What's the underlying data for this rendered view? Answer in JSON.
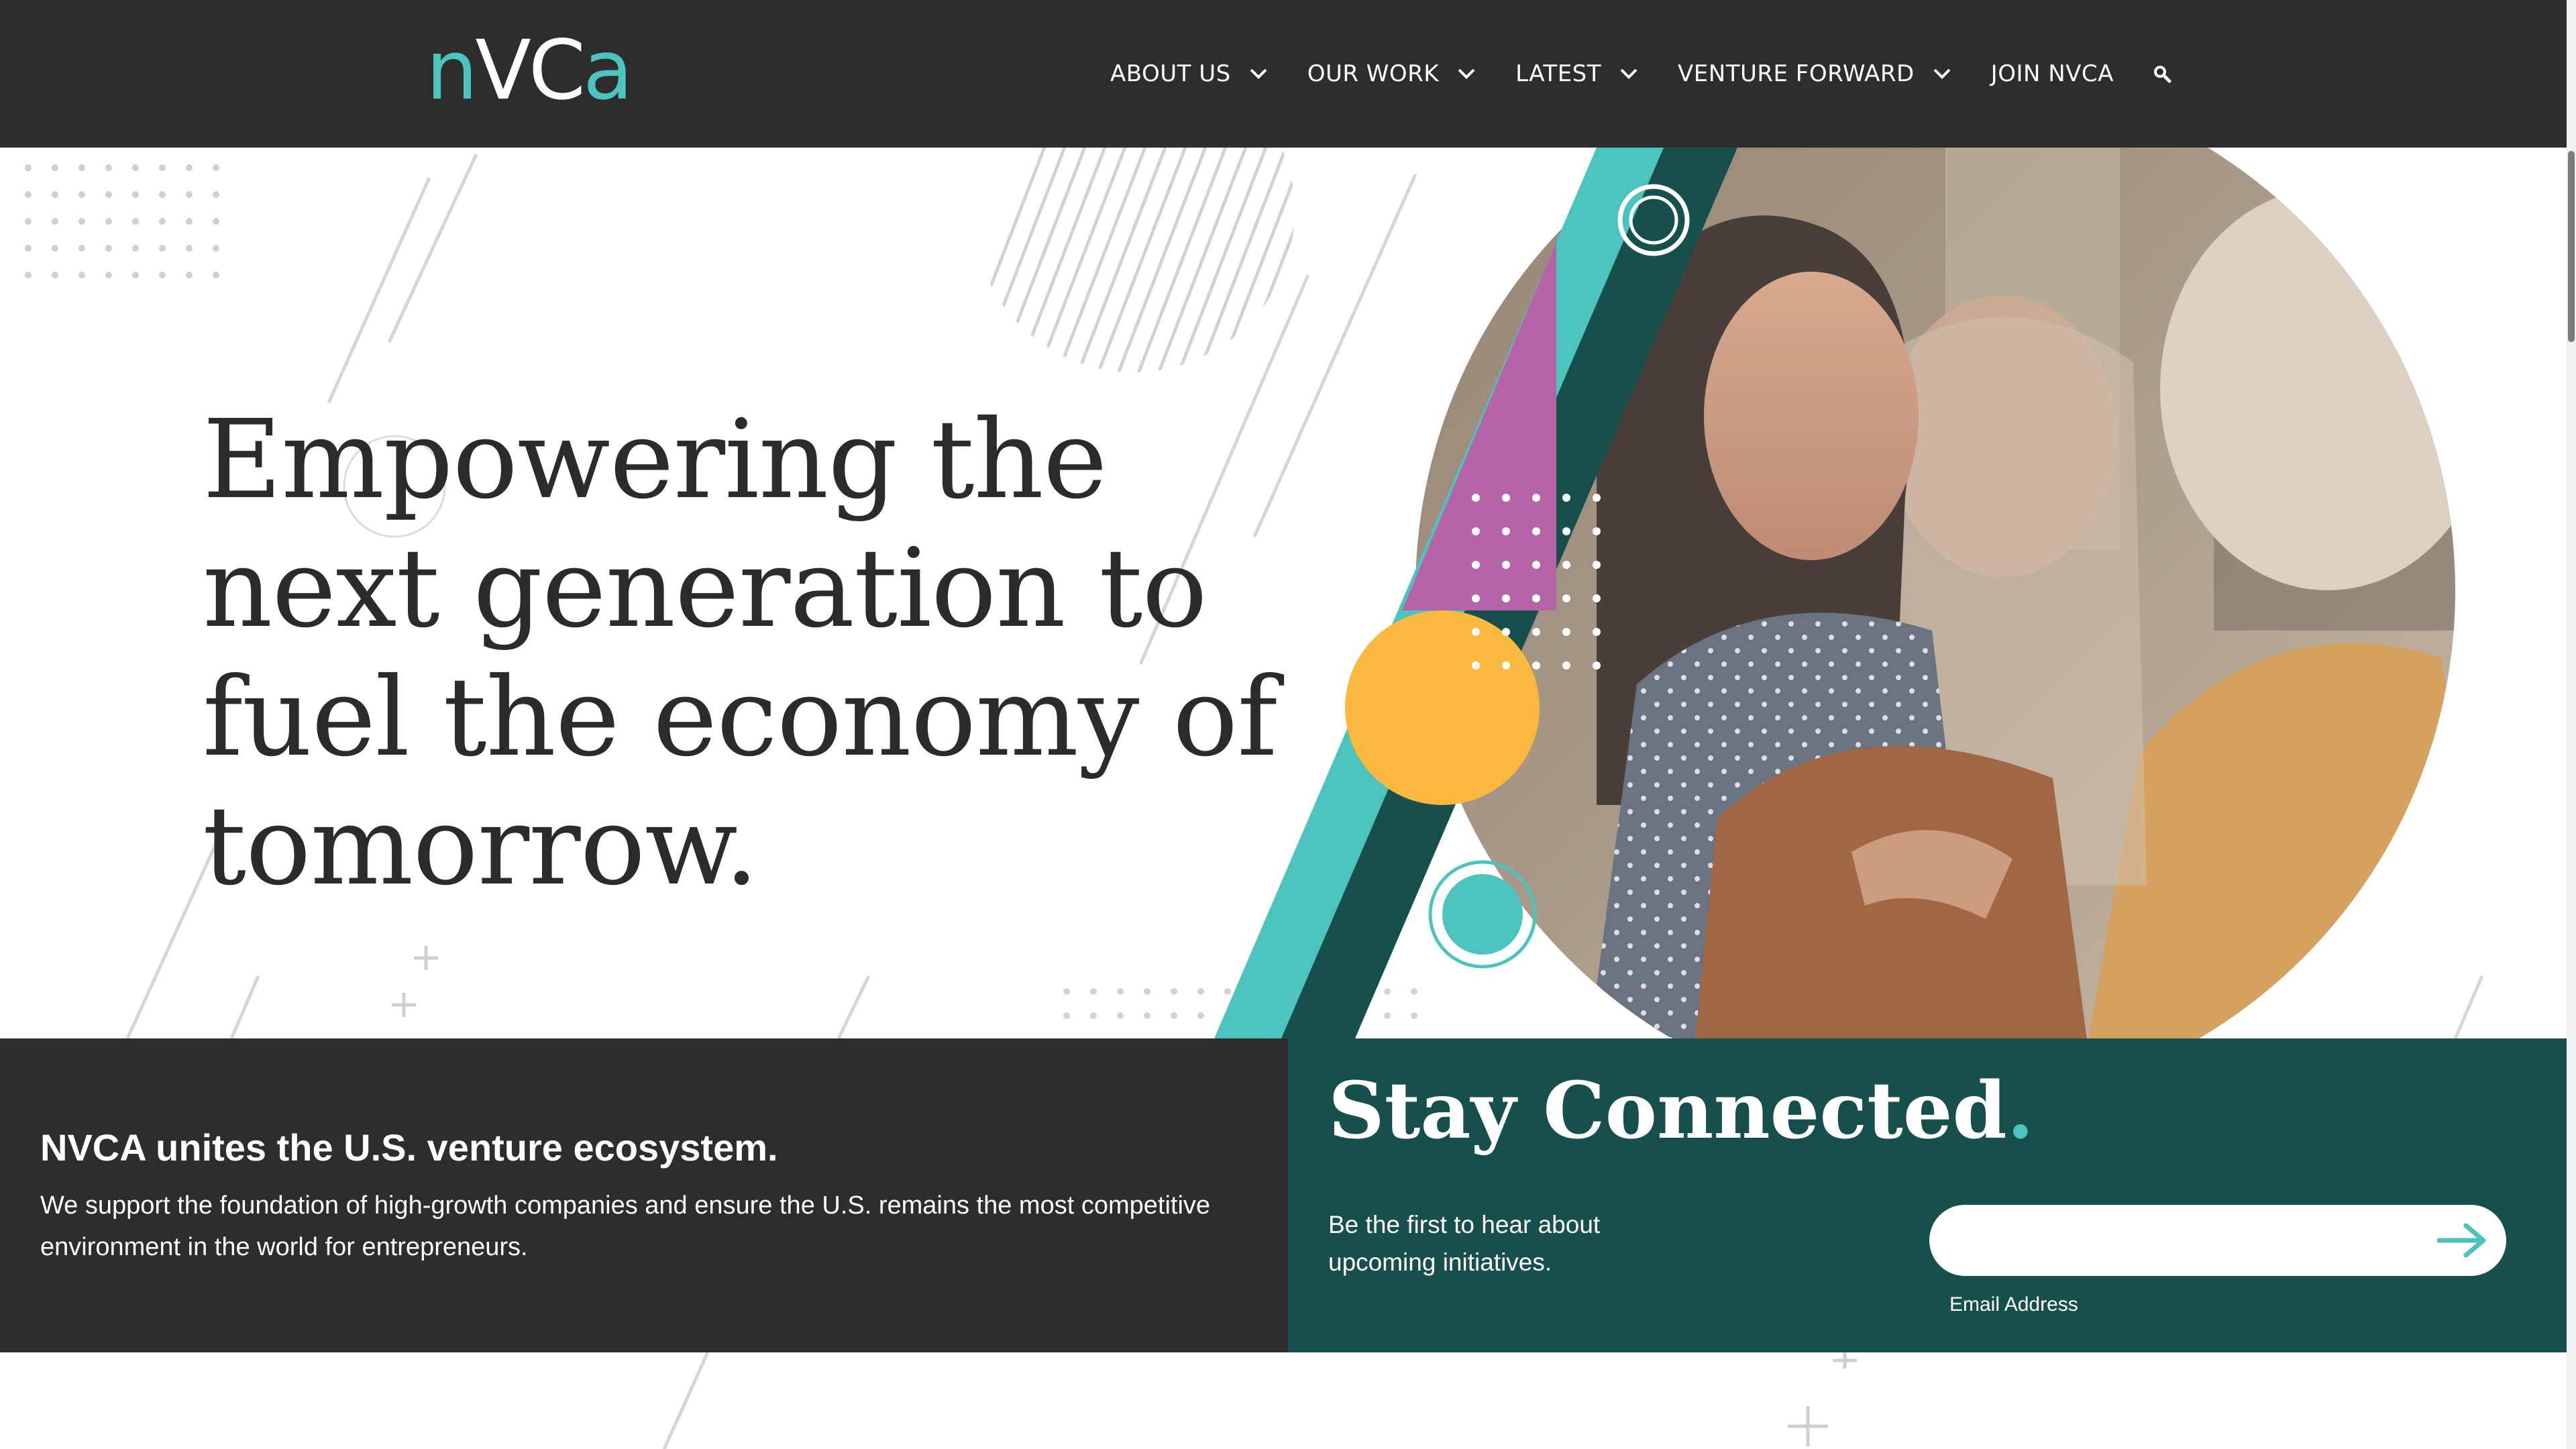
{
  "header": {
    "logo_text_a": "n",
    "logo_text_b": "VC",
    "logo_text_c": "a",
    "nav": [
      {
        "label": "ABOUT US",
        "has_dropdown": true
      },
      {
        "label": "OUR WORK",
        "has_dropdown": true
      },
      {
        "label": "LATEST",
        "has_dropdown": true
      },
      {
        "label": "VENTURE FORWARD",
        "has_dropdown": true
      },
      {
        "label": "JOIN NVCA",
        "has_dropdown": false
      }
    ],
    "search_icon": "search-icon"
  },
  "hero": {
    "title": "Empowering the next generation to fuel the economy of tomorrow."
  },
  "about_band": {
    "title": "NVCA unites the U.S. venture ecosystem.",
    "body": "We support the foundation of high-growth companies and ensure the U.S. remains the most competitive environment in the world for entrepreneurs."
  },
  "newsletter": {
    "title": "Stay Connected",
    "title_dot": ".",
    "subtitle": "Be the first to hear about upcoming initiatives.",
    "email_value": "",
    "email_label": "Email Address",
    "submit_icon": "arrow-right-icon"
  },
  "colors": {
    "dark": "#2d2d2d",
    "teal": "#4cc3bd",
    "dark_teal": "#174f4d",
    "purple": "#b565a7",
    "yellow": "#fbb83e"
  }
}
